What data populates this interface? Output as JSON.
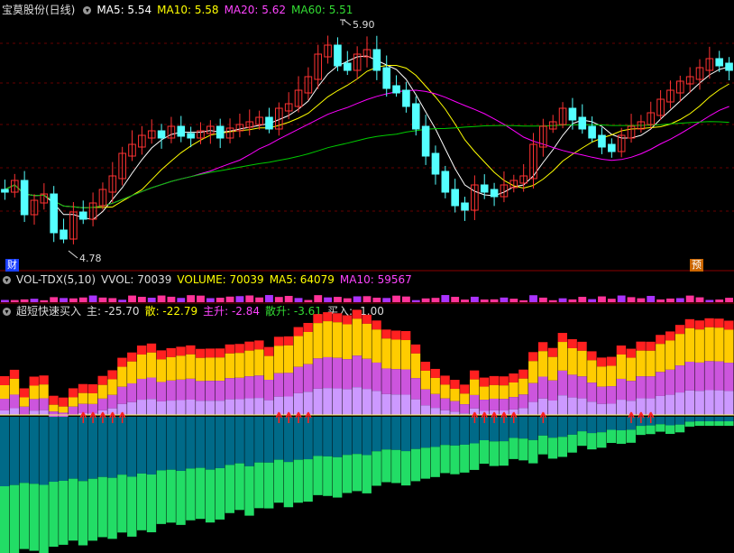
{
  "main": {
    "title": "宝莫股份(日线)",
    "ma5": "MA5: 5.54",
    "ma10": "MA10: 5.58",
    "ma20": "MA20: 5.62",
    "ma60": "MA60: 5.51",
    "high_label": "5.90",
    "low_label": "4.78",
    "badge_left": "财",
    "badge_right": "预"
  },
  "volume": {
    "title": "VOL-TDX(5,10)",
    "vvol": "VVOL: 70039",
    "volume": "VOLUME: 70039",
    "ma5": "MA5: 64079",
    "ma10": "MA10: 59567"
  },
  "indicator": {
    "title": "超短快速买入",
    "zhu": "主: -25.70",
    "san": "散: -22.79",
    "zhusheng": "主升: -2.84",
    "sansheng": "散升: -3.61",
    "mairu": "买入: -1.00"
  },
  "colors": {
    "up": "#ff3232",
    "down": "#54ffff",
    "ma5": "#ffffff",
    "ma10": "#ffff00",
    "ma20": "#ff00ff",
    "ma60": "#00cc00"
  }
}
